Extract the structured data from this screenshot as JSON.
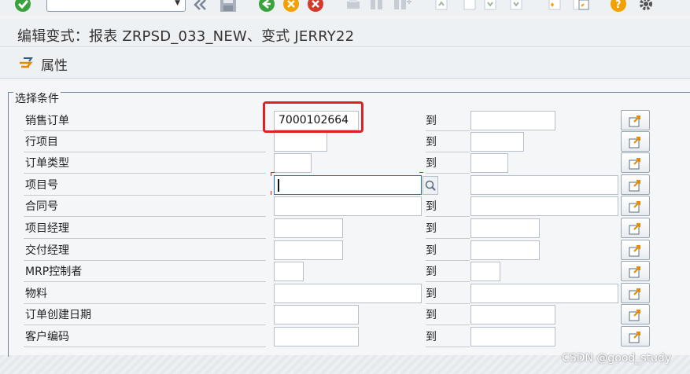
{
  "toolbar": {
    "command_field_value": "",
    "icons": [
      "check-icon",
      "double-chevron-left-icon",
      "save-icon",
      "back-icon",
      "exit-icon",
      "cancel-icon",
      "print-icon",
      "find-icon",
      "find-next-icon",
      "first-page-icon",
      "prev-page-icon",
      "next-page-icon",
      "last-page-icon",
      "create-session-icon",
      "shortcut-icon",
      "help-icon",
      "settings-icon"
    ]
  },
  "title": "编辑变式：报表 ZRPSD_033_NEW、变式 JERRY22",
  "app_toolbar": {
    "attributes_label": "属性"
  },
  "group": {
    "title": "选择条件"
  },
  "to_label": "到",
  "rows": [
    {
      "label": "销售订单",
      "low": "7000102664",
      "high": ""
    },
    {
      "label": "行项目",
      "low": "",
      "high": ""
    },
    {
      "label": "订单类型",
      "low": "",
      "high": ""
    },
    {
      "label": "项目号",
      "low": "",
      "high": ""
    },
    {
      "label": "合同号",
      "low": "",
      "high": ""
    },
    {
      "label": "项目经理",
      "low": "",
      "high": ""
    },
    {
      "label": "交付经理",
      "low": "",
      "high": ""
    },
    {
      "label": "MRP控制者",
      "low": "",
      "high": ""
    },
    {
      "label": "物料",
      "low": "",
      "high": ""
    },
    {
      "label": "订单创建日期",
      "low": "",
      "high": ""
    },
    {
      "label": "客户编码",
      "low": "",
      "high": ""
    }
  ],
  "watermark": "CSDN @good_study",
  "colors": {
    "highlight": "#dd2222",
    "focus": "#1d73c9",
    "accent_green": "#3aa23a",
    "accent_orange": "#f2a100",
    "accent_red": "#d43a2a"
  }
}
